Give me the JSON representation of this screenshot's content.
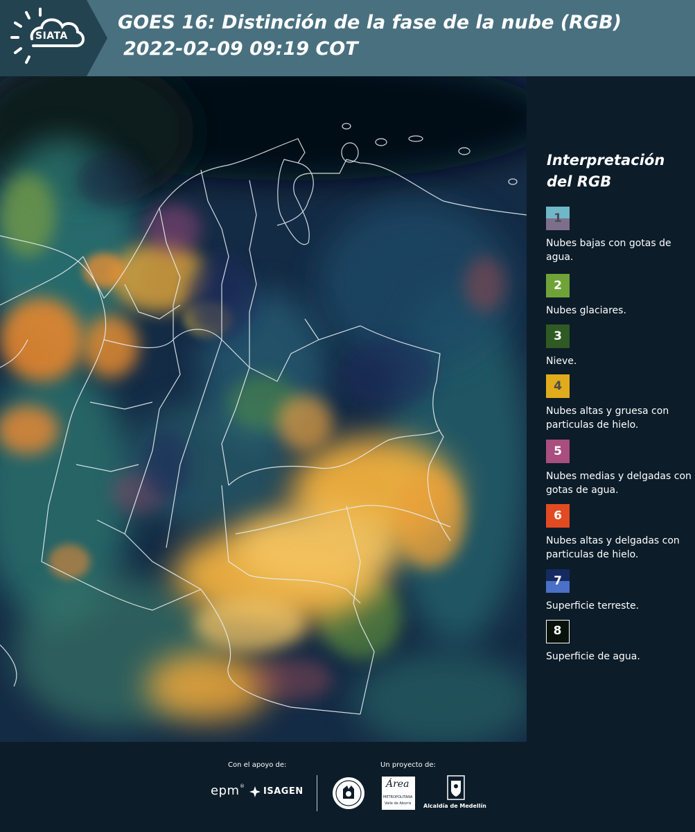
{
  "header": {
    "logo_text": "SIATA",
    "title_line1": "GOES 16: Distinción de la fase de la nube (RGB)",
    "title_line2": "2022-02-09 09:19 COT"
  },
  "legend": {
    "title": "Interpretación del RGB",
    "items": [
      {
        "number": "1",
        "label": "Nubes bajas con gotas de agua.",
        "color_top": "#6fb8c8",
        "color_bottom": "#7d6f8c",
        "num_color": "#4a4a5a"
      },
      {
        "number": "2",
        "label": "Nubes glaciares.",
        "color_top": "#6fa338",
        "color_bottom": "#6fa338",
        "num_color": "#ffffff"
      },
      {
        "number": "3",
        "label": "Nieve.",
        "color_top": "#2f5a24",
        "color_bottom": "#2f5a24",
        "num_color": "#ffffff"
      },
      {
        "number": "4",
        "label": "Nubes altas y gruesa con particulas de hielo.",
        "color_top": "#e0ac1c",
        "color_bottom": "#e0ac1c",
        "num_color": "#4a4a4a"
      },
      {
        "number": "5",
        "label": "Nubes medias y delgadas con gotas de agua.",
        "color_top": "#a94e7e",
        "color_bottom": "#a94e7e",
        "num_color": "#ffffff"
      },
      {
        "number": "6",
        "label": "Nubes altas y delgadas con particulas de hielo.",
        "color_top": "#e24a22",
        "color_bottom": "#e24a22",
        "num_color": "#ffffff"
      },
      {
        "number": "7",
        "label": "Superficie terreste.",
        "color_top": "#142a60",
        "color_bottom": "#4a70c8",
        "num_color": "#ffffff"
      },
      {
        "number": "8",
        "label": "Superficie de agua.",
        "color_top": "#08120a",
        "color_bottom": "#08120a",
        "num_color": "#ffffff"
      }
    ]
  },
  "footer": {
    "support_label": "Con el apoyo de:",
    "project_label": "Un proyecto de:",
    "support_logos": [
      "epm",
      "ISAGEN"
    ],
    "project_logos": [
      "Área",
      "METROPOLITANA",
      "Valle de Aburrá",
      "Alcaldía de Medellín"
    ]
  }
}
